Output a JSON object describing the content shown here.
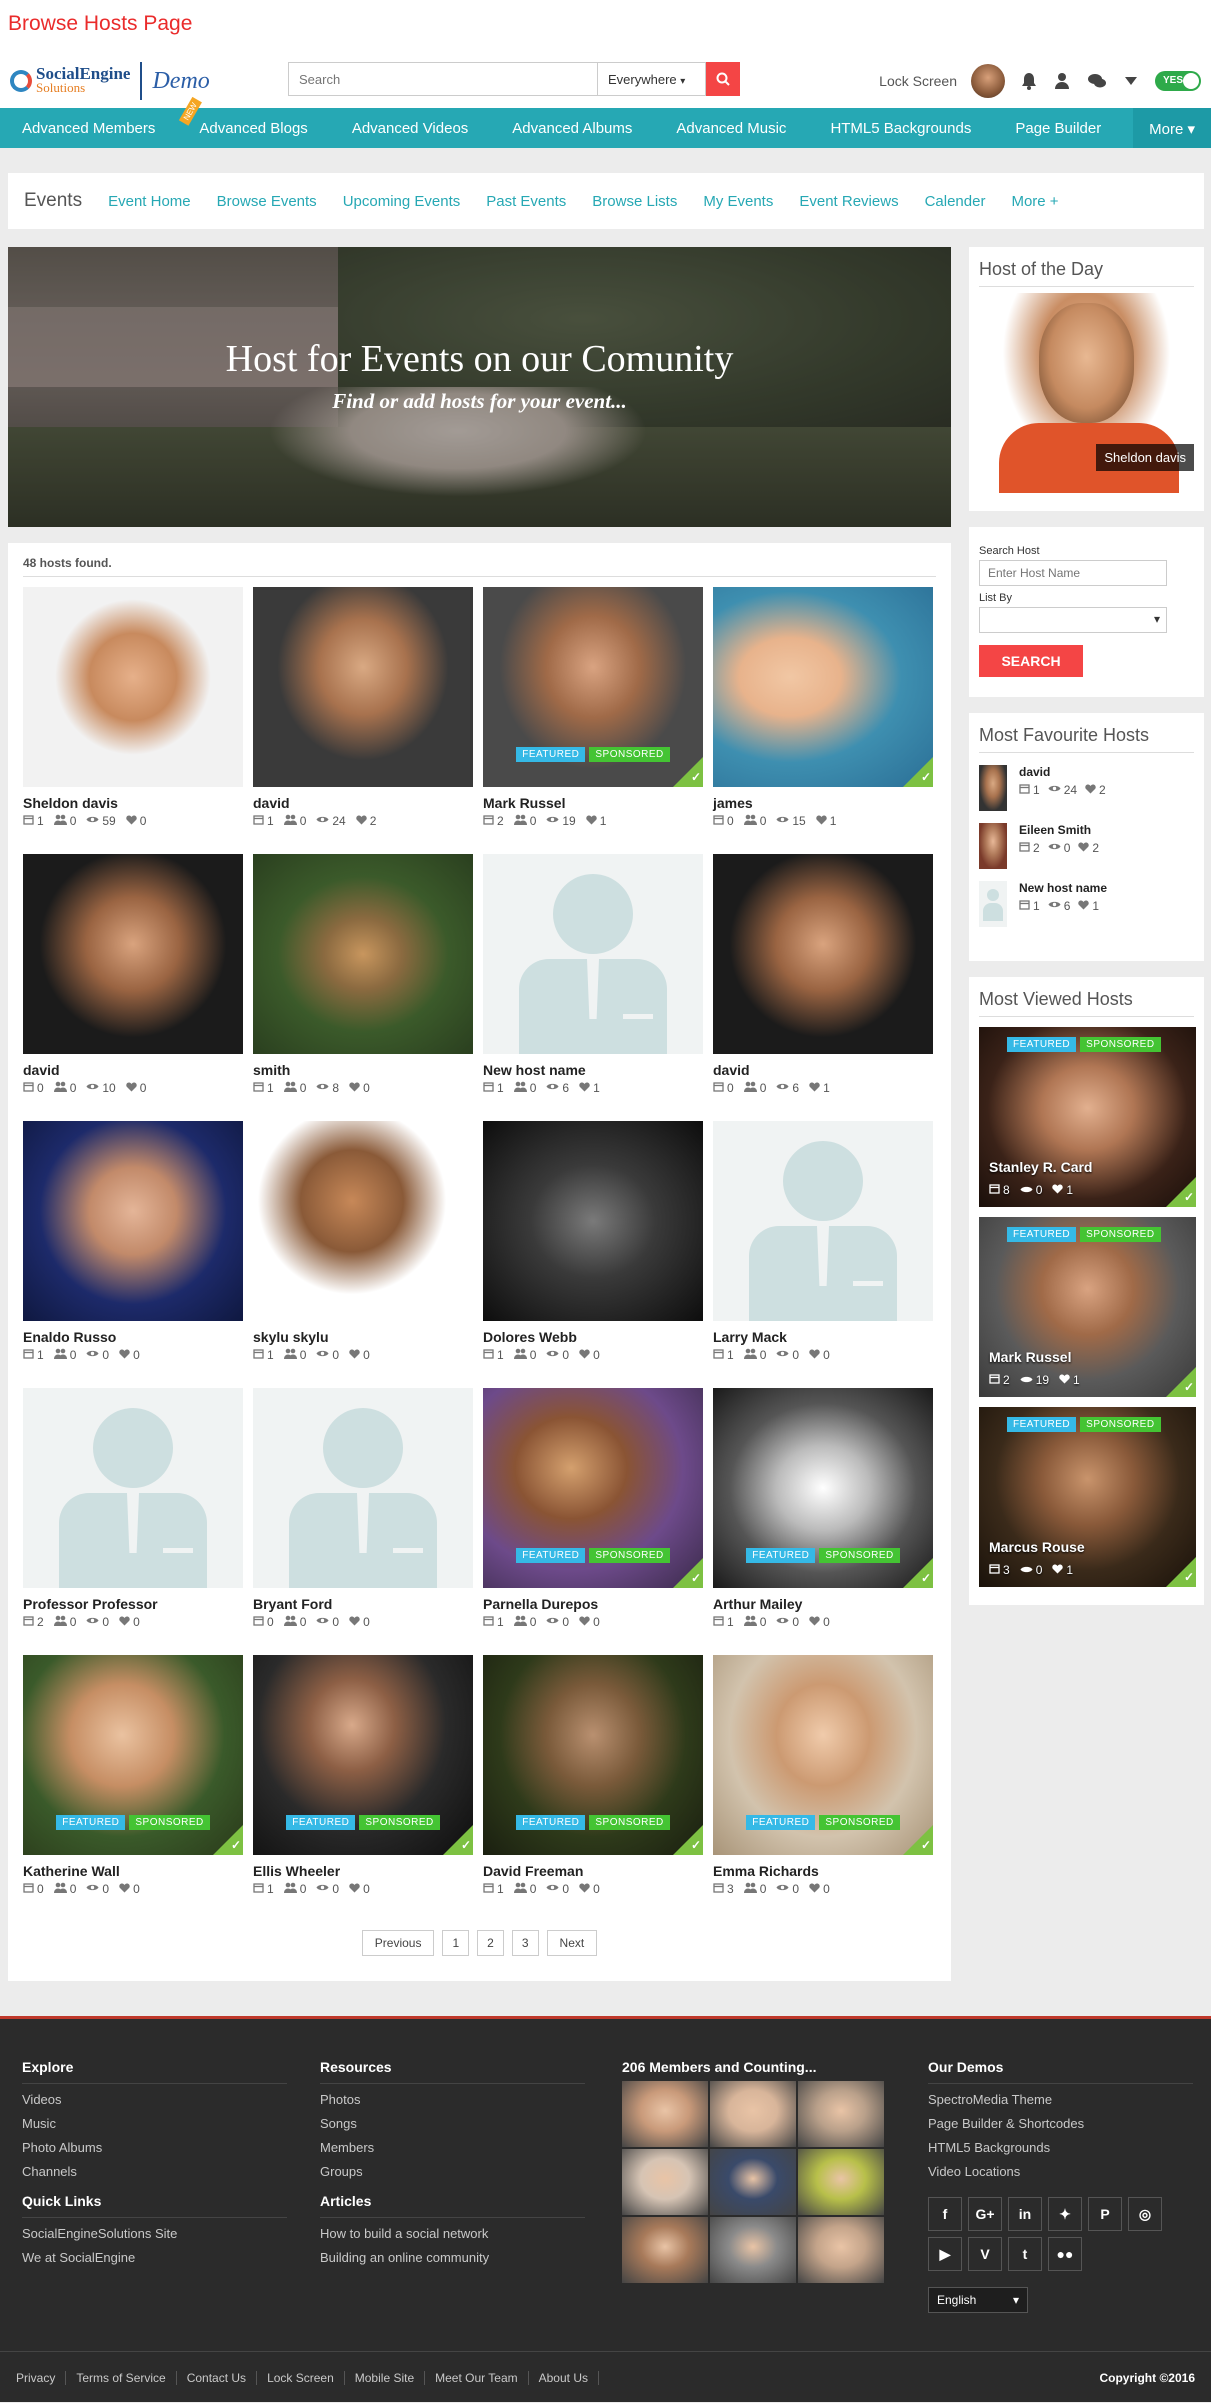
{
  "page_title": "Browse Hosts Page",
  "header": {
    "logo_main": "SocialEngine",
    "logo_sub": "Solutions",
    "logo_demo": "Demo",
    "search_placeholder": "Search",
    "location_value": "Everywhere",
    "lock_screen": "Lock Screen",
    "toggle_label": "YES"
  },
  "main_nav": {
    "items": [
      "Advanced Members",
      "Advanced Blogs",
      "Advanced Videos",
      "Advanced Albums",
      "Advanced Music",
      "HTML5 Backgrounds",
      "Page Builder"
    ],
    "new_tag": "NEW",
    "more": "More"
  },
  "sub_nav": {
    "title": "Events",
    "links": [
      "Event Home",
      "Browse Events",
      "Upcoming Events",
      "Past Events",
      "Browse Lists",
      "My Events",
      "Event Reviews",
      "Calender",
      "More +"
    ]
  },
  "banner": {
    "title": "Host for Events on our Comunity",
    "subtitle": "Find or add hosts for your event..."
  },
  "list": {
    "found_text": "48 hosts found.",
    "featured_label": "FEATURED",
    "sponsored_label": "SPONSORED",
    "hosts": [
      {
        "name": "Sheldon davis",
        "events": "1",
        "members": "0",
        "views": "59",
        "likes": "0"
      },
      {
        "name": "david",
        "events": "1",
        "members": "0",
        "views": "24",
        "likes": "2"
      },
      {
        "name": "Mark Russel",
        "events": "2",
        "members": "0",
        "views": "19",
        "likes": "1"
      },
      {
        "name": "james",
        "events": "0",
        "members": "0",
        "views": "15",
        "likes": "1"
      },
      {
        "name": "david",
        "events": "0",
        "members": "0",
        "views": "10",
        "likes": "0"
      },
      {
        "name": "smith",
        "events": "1",
        "members": "0",
        "views": "8",
        "likes": "0"
      },
      {
        "name": "New host name",
        "events": "1",
        "members": "0",
        "views": "6",
        "likes": "1"
      },
      {
        "name": "david",
        "events": "0",
        "members": "0",
        "views": "6",
        "likes": "1"
      },
      {
        "name": "Enaldo Russo",
        "events": "1",
        "members": "0",
        "views": "0",
        "likes": "0"
      },
      {
        "name": "skylu skylu",
        "events": "1",
        "members": "0",
        "views": "0",
        "likes": "0"
      },
      {
        "name": "Dolores Webb",
        "events": "1",
        "members": "0",
        "views": "0",
        "likes": "0"
      },
      {
        "name": "Larry Mack",
        "events": "1",
        "members": "0",
        "views": "0",
        "likes": "0"
      },
      {
        "name": "Professor Professor",
        "events": "2",
        "members": "0",
        "views": "0",
        "likes": "0"
      },
      {
        "name": "Bryant Ford",
        "events": "0",
        "members": "0",
        "views": "0",
        "likes": "0"
      },
      {
        "name": "Parnella Durepos",
        "events": "1",
        "members": "0",
        "views": "0",
        "likes": "0"
      },
      {
        "name": "Arthur Mailey",
        "events": "1",
        "members": "0",
        "views": "0",
        "likes": "0"
      },
      {
        "name": "Katherine Wall",
        "events": "0",
        "members": "0",
        "views": "0",
        "likes": "0"
      },
      {
        "name": "Ellis Wheeler",
        "events": "1",
        "members": "0",
        "views": "0",
        "likes": "0"
      },
      {
        "name": "David Freeman",
        "events": "1",
        "members": "0",
        "views": "0",
        "likes": "0"
      },
      {
        "name": "Emma Richards",
        "events": "3",
        "members": "0",
        "views": "0",
        "likes": "0"
      }
    ]
  },
  "pagination": {
    "previous": "Previous",
    "pages": [
      "1",
      "2",
      "3"
    ],
    "next": "Next"
  },
  "sidebar": {
    "host_of_day": {
      "title": "Host of the Day",
      "name": "Sheldon davis"
    },
    "search": {
      "label_host": "Search Host",
      "host_placeholder": "Enter Host Name",
      "label_list": "List By",
      "button": "SEARCH"
    },
    "favourite": {
      "title": "Most Favourite Hosts",
      "items": [
        {
          "name": "david",
          "events": "1",
          "views": "24",
          "likes": "2"
        },
        {
          "name": "Eileen Smith",
          "events": "2",
          "views": "0",
          "likes": "2"
        },
        {
          "name": "New host name",
          "events": "1",
          "views": "6",
          "likes": "1"
        }
      ]
    },
    "viewed": {
      "title": "Most Viewed Hosts",
      "items": [
        {
          "name": "Stanley R. Card",
          "events": "8",
          "views": "0",
          "likes": "1"
        },
        {
          "name": "Mark Russel",
          "events": "2",
          "views": "19",
          "likes": "1"
        },
        {
          "name": "Marcus Rouse",
          "events": "3",
          "views": "0",
          "likes": "1"
        }
      ]
    }
  },
  "footer": {
    "explore": {
      "title": "Explore",
      "links": [
        "Videos",
        "Music",
        "Photo Albums",
        "Channels"
      ]
    },
    "quick_links": {
      "title": "Quick Links",
      "links": [
        "SocialEngineSolutions Site",
        "We at SocialEngine"
      ]
    },
    "resources": {
      "title": "Resources",
      "links": [
        "Photos",
        "Songs",
        "Members",
        "Groups"
      ]
    },
    "articles": {
      "title": "Articles",
      "links": [
        "How to build a social network",
        "Building an online community"
      ]
    },
    "members": {
      "title": "206 Members and Counting..."
    },
    "demos": {
      "title": "Our Demos",
      "links": [
        "SpectroMedia Theme",
        "Page Builder & Shortcodes",
        "HTML5 Backgrounds",
        "Video Locations"
      ]
    },
    "language": "English",
    "bottom_links": [
      "Privacy",
      "Terms of Service",
      "Contact Us",
      "Lock Screen",
      "Mobile Site",
      "Meet Our Team",
      "About Us"
    ],
    "copyright": "Copyright ©2016"
  },
  "colors": {
    "accent_teal": "#26a8b4",
    "accent_red": "#f44545",
    "featured": "#35b9e6",
    "sponsored": "#44c433"
  }
}
